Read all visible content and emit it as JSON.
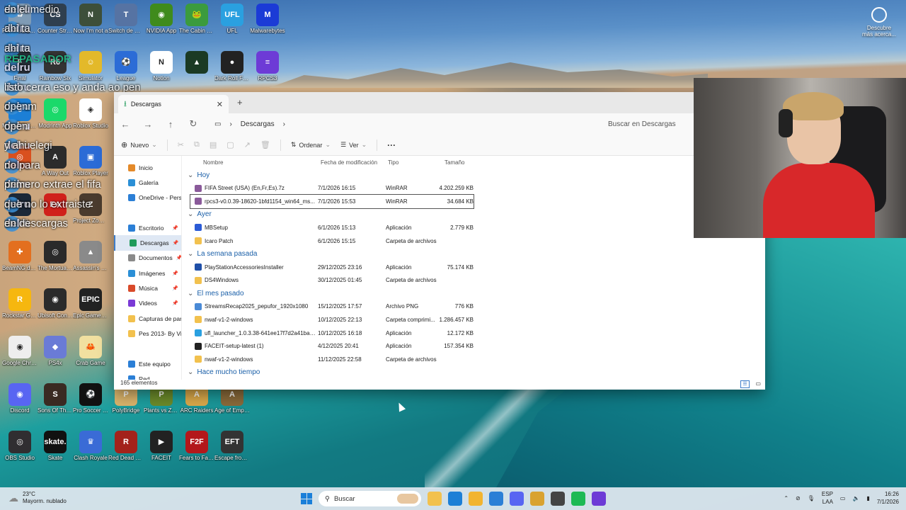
{
  "desktop_icons": [
    {
      "label": "Papelera de reciclaje",
      "color": "#7f9bb5",
      "glyph": "♻",
      "col": 0,
      "row": 0
    },
    {
      "label": "Counter Strike",
      "color": "#2f3f4f",
      "glyph": "CS",
      "col": 1,
      "row": 0
    },
    {
      "label": "Now I'm not a",
      "color": "#3d4f3a",
      "glyph": "N",
      "col": 2,
      "row": 0
    },
    {
      "label": "Switch de Eggs",
      "color": "#5673a3",
      "glyph": "T",
      "col": 3,
      "row": 0
    },
    {
      "label": "NVIDIA App",
      "color": "#3f8b1c",
      "glyph": "◉",
      "col": 4,
      "row": 0
    },
    {
      "label": "The Cabin Factory",
      "color": "#3b9b3e",
      "glyph": "🐸",
      "col": 5,
      "row": 0
    },
    {
      "label": "UFL",
      "color": "#2aa0e0",
      "glyph": "UFL",
      "col": 6,
      "row": 0
    },
    {
      "label": "Malwarebytes",
      "color": "#1b3bd6",
      "glyph": "M",
      "col": 7,
      "row": 0
    },
    {
      "label": "Final",
      "color": "#27303a",
      "glyph": "F",
      "col": 0,
      "row": 1
    },
    {
      "label": "Rainbow Six",
      "color": "#333",
      "glyph": "R6",
      "col": 1,
      "row": 1
    },
    {
      "label": "Simulator",
      "color": "#e3b92a",
      "glyph": "☺",
      "col": 2,
      "row": 1
    },
    {
      "label": "League",
      "color": "#2c6cd6",
      "glyph": "⚽",
      "col": 3,
      "row": 1
    },
    {
      "label": "Notion",
      "color": "#fff",
      "glyph": "N",
      "col": 4,
      "row": 1
    },
    {
      "label": "",
      "color": "#1b3a24",
      "glyph": "▲",
      "col": 5,
      "row": 1
    },
    {
      "label": "Dark Roll Free Kick Challe...",
      "color": "#222",
      "glyph": "●",
      "col": 6,
      "row": 1
    },
    {
      "label": "RPCS3",
      "color": "#6d3bd6",
      "glyph": "≡",
      "col": 7,
      "row": 1
    },
    {
      "label": "Microsoft Edge",
      "color": "#1c7fd6",
      "glyph": "e",
      "col": 0,
      "row": 2
    },
    {
      "label": "Modrinth App",
      "color": "#1bd96a",
      "glyph": "◎",
      "col": 1,
      "row": 2
    },
    {
      "label": "Roblox Studio",
      "color": "#fff",
      "glyph": "◈",
      "col": 2,
      "row": 2
    },
    {
      "label": "",
      "color": "#d9501f",
      "glyph": "◎",
      "col": 0,
      "row": 3
    },
    {
      "label": "A Way Out",
      "color": "#2b2b2b",
      "glyph": "A",
      "col": 1,
      "row": 3
    },
    {
      "label": "Roblox Player",
      "color": "#2b6bd6",
      "glyph": "▣",
      "col": 2,
      "row": 3
    },
    {
      "label": "Steam",
      "color": "#1b2838",
      "glyph": "S",
      "col": 0,
      "row": 4
    },
    {
      "label": "",
      "color": "#d0211b",
      "glyph": "EA",
      "col": 1,
      "row": 4
    },
    {
      "label": "Project Zomboid",
      "color": "#4a3b2e",
      "glyph": "Z",
      "col": 2,
      "row": 4
    },
    {
      "label": "BeamNG.drive",
      "color": "#e36f1f",
      "glyph": "✚",
      "col": 0,
      "row": 5
    },
    {
      "label": "The Mortuary Assistant",
      "color": "#2a2a2a",
      "glyph": "◎",
      "col": 1,
      "row": 5
    },
    {
      "label": "Assassin's Creed",
      "color": "#8a8a8a",
      "glyph": "▲",
      "col": 2,
      "row": 5
    },
    {
      "label": "Rockstar Games",
      "color": "#f6b70f",
      "glyph": "R",
      "col": 0,
      "row": 6
    },
    {
      "label": "Ubisoft Connect",
      "color": "#2b2b2b",
      "glyph": "◉",
      "col": 1,
      "row": 6
    },
    {
      "label": "Epic Games Launcher",
      "color": "#222",
      "glyph": "EPIC",
      "col": 2,
      "row": 6
    },
    {
      "label": "Google Chrome",
      "color": "#eee",
      "glyph": "◉",
      "col": 0,
      "row": 7
    },
    {
      "label": "PS4x",
      "color": "#6a7bd6",
      "glyph": "◆",
      "col": 1,
      "row": 7
    },
    {
      "label": "Crab Game",
      "color": "#f1e0a0",
      "glyph": "🦀",
      "col": 2,
      "row": 7
    },
    {
      "label": "Discord",
      "color": "#5865f2",
      "glyph": "◉",
      "col": 0,
      "row": 8
    },
    {
      "label": "Sons Of The Forest",
      "color": "#3a2a22",
      "glyph": "S",
      "col": 1,
      "row": 8
    },
    {
      "label": "Pro Soccer Online",
      "color": "#111",
      "glyph": "⚽",
      "col": 2,
      "row": 8
    },
    {
      "label": "PolyBridge",
      "color": "#d9b36b",
      "glyph": "P",
      "col": 3,
      "row": 8
    },
    {
      "label": "Plants vs Zombies Tr...",
      "color": "#6b8a2a",
      "glyph": "P",
      "col": 4,
      "row": 8
    },
    {
      "label": "ARC Raiders",
      "color": "#d9a84a",
      "glyph": "A",
      "col": 5,
      "row": 8
    },
    {
      "label": "Age of Empires",
      "color": "#8a6a3a",
      "glyph": "A",
      "col": 6,
      "row": 8
    },
    {
      "label": "OBS Studio",
      "color": "#302e31",
      "glyph": "◎",
      "col": 0,
      "row": 9
    },
    {
      "label": "Skate",
      "color": "#111",
      "glyph": "skate.",
      "col": 1,
      "row": 9
    },
    {
      "label": "Clash Royale",
      "color": "#3a6bd6",
      "glyph": "♛",
      "col": 2,
      "row": 9
    },
    {
      "label": "Red Dead Redempti...",
      "color": "#a3221b",
      "glyph": "R",
      "col": 3,
      "row": 9
    },
    {
      "label": "FACEIT",
      "color": "#222",
      "glyph": "▶",
      "col": 4,
      "row": 9
    },
    {
      "label": "Fears to Fathom",
      "color": "#b3171b",
      "glyph": "F2F",
      "col": 5,
      "row": 9
    },
    {
      "label": "Escape from Tarkov",
      "color": "#333",
      "glyph": "EFT",
      "col": 6,
      "row": 9
    }
  ],
  "chat": [
    {
      "user": "delru",
      "msg": "en el medio"
    },
    {
      "user": "delru",
      "msg": "ahi ta"
    },
    {
      "user": "delru",
      "msg": "ahi ta"
    },
    {
      "user": "delru",
      "msg": ""
    },
    {
      "user": "delru",
      "msg": "listo cerra eso y anda ao pen"
    },
    {
      "user": "delru",
      "msg": "openm"
    },
    {
      "user": "delru",
      "msg": "open"
    },
    {
      "user": "delru",
      "msg": "y ahi elegi"
    },
    {
      "user": "delru",
      "msg": "no para"
    },
    {
      "user": "delru",
      "msg": "primero extrae el fifa"
    },
    {
      "user": "delru",
      "msg": "que no lo extraiste"
    },
    {
      "user": "delru",
      "msg": "en descargas"
    }
  ],
  "chat_banner": "REPASADOR",
  "discover": {
    "label": "Descubre más acerca..."
  },
  "explorer": {
    "tab_title": "Descargas",
    "breadcrumb": "Descargas",
    "search_placeholder": "Buscar en Descargas",
    "toolbar": {
      "new": "Nuevo",
      "sort": "Ordenar",
      "view": "Ver",
      "more": "···"
    },
    "columns": {
      "name": "Nombre",
      "date": "Fecha de modificación",
      "type": "Tipo",
      "size": "Tamaño"
    },
    "sidebar": [
      {
        "label": "Inicio",
        "icon": "home-icon",
        "color": "#e48a2a",
        "pin": false,
        "sel": false
      },
      {
        "label": "Galería",
        "icon": "gallery-icon",
        "color": "#2b8fd6",
        "pin": false,
        "sel": false
      },
      {
        "label": "OneDrive - Pers",
        "icon": "cloud-icon",
        "color": "#2b7fd6",
        "pin": false,
        "sel": false
      },
      {
        "label": "",
        "icon": "",
        "color": "transparent",
        "pin": false,
        "sel": false
      },
      {
        "label": "Escritorio",
        "icon": "desktop-icon",
        "color": "#2b7fd6",
        "pin": true,
        "sel": false
      },
      {
        "label": "Descargas",
        "icon": "download-icon",
        "color": "#1f9a5a",
        "pin": true,
        "sel": true
      },
      {
        "label": "Documentos",
        "icon": "document-icon",
        "color": "#8a8a8a",
        "pin": true,
        "sel": false
      },
      {
        "label": "Imágenes",
        "icon": "image-icon",
        "color": "#2b8fd6",
        "pin": true,
        "sel": false
      },
      {
        "label": "Música",
        "icon": "music-icon",
        "color": "#d94a2a",
        "pin": true,
        "sel": false
      },
      {
        "label": "Videos",
        "icon": "video-icon",
        "color": "#7a3ad6",
        "pin": true,
        "sel": false
      },
      {
        "label": "Capturas de par",
        "icon": "folder-icon",
        "color": "#f2c14e",
        "pin": false,
        "sel": false
      },
      {
        "label": "Pes 2013- By Vir",
        "icon": "folder-icon",
        "color": "#f2c14e",
        "pin": false,
        "sel": false
      },
      {
        "label": "",
        "icon": "",
        "color": "transparent",
        "pin": false,
        "sel": false
      },
      {
        "label": "Este equipo",
        "icon": "computer-icon",
        "color": "#2b7fd6",
        "pin": false,
        "sel": false
      },
      {
        "label": "Red",
        "icon": "network-icon",
        "color": "#2b7fd6",
        "pin": false,
        "sel": false
      }
    ],
    "groups": [
      {
        "title": "Hoy",
        "files": [
          {
            "name": "FIFA Street (USA) (En,Fr,Es).7z",
            "date": "7/1/2026 16:15",
            "type": "WinRAR",
            "size": "4.202.259 KB",
            "color": "#8a5a9a",
            "sel": false
          },
          {
            "name": "rpcs3-v0.0.39-18620-1bfd1154_win64_ms...",
            "date": "7/1/2026 15:53",
            "type": "WinRAR",
            "size": "34.684 KB",
            "color": "#8a5a9a",
            "sel": true
          }
        ]
      },
      {
        "title": "Ayer",
        "files": [
          {
            "name": "MBSetup",
            "date": "6/1/2026 15:13",
            "type": "Aplicación",
            "size": "2.779 KB",
            "color": "#2b5bd6",
            "sel": false
          },
          {
            "name": "Icaro Patch",
            "date": "6/1/2026 15:15",
            "type": "Carpeta de archivos",
            "size": "",
            "color": "#f2c14e",
            "sel": false
          }
        ]
      },
      {
        "title": "La semana pasada",
        "files": [
          {
            "name": "PlayStationAccessoriesInstaller",
            "date": "29/12/2025 23:16",
            "type": "Aplicación",
            "size": "75.174 KB",
            "color": "#1f4fa8",
            "sel": false
          },
          {
            "name": "DS4Windows",
            "date": "30/12/2025 01:45",
            "type": "Carpeta de archivos",
            "size": "",
            "color": "#f2c14e",
            "sel": false
          }
        ]
      },
      {
        "title": "El mes pasado",
        "files": [
          {
            "name": "StreamsRecap2025_pepufor_1920x1080",
            "date": "15/12/2025 17:57",
            "type": "Archivo PNG",
            "size": "776 KB",
            "color": "#4a8ad6",
            "sel": false
          },
          {
            "name": "nwaf-v1-2-windows",
            "date": "10/12/2025 22:13",
            "type": "Carpeta comprimi...",
            "size": "1.286.457 KB",
            "color": "#f2c14e",
            "sel": false
          },
          {
            "name": "ufl_launcher_1.0.3.38-641ee17f7d2a41ba9...",
            "date": "10/12/2025 16:18",
            "type": "Aplicación",
            "size": "12.172 KB",
            "color": "#2aa0e0",
            "sel": false
          },
          {
            "name": "FACEIT-setup-latest (1)",
            "date": "4/12/2025 20:41",
            "type": "Aplicación",
            "size": "157.354 KB",
            "color": "#222",
            "sel": false
          },
          {
            "name": "nwaf-v1-2-windows",
            "date": "11/12/2025 22:58",
            "type": "Carpeta de archivos",
            "size": "",
            "color": "#f2c14e",
            "sel": false
          }
        ]
      },
      {
        "title": "Hace mucho tiempo",
        "files": []
      }
    ],
    "status": "165 elementos"
  },
  "taskbar": {
    "weather_temp": "23°C",
    "weather_desc": "Mayorm. nublado",
    "search": "Buscar",
    "apps": [
      {
        "name": "file-explorer-icon",
        "color": "#f2c14e"
      },
      {
        "name": "edge-icon",
        "color": "#1c7fd6"
      },
      {
        "name": "folder-icon",
        "color": "#f2b430"
      },
      {
        "name": "store-icon",
        "color": "#2b7fd6"
      },
      {
        "name": "discord-icon",
        "color": "#5865f2"
      },
      {
        "name": "chrome-icon",
        "color": "#d9a230"
      },
      {
        "name": "obs-icon",
        "color": "#444"
      },
      {
        "name": "spotify-icon",
        "color": "#1db954"
      },
      {
        "name": "rpcs3-icon",
        "color": "#6d3bd6"
      }
    ],
    "lang": "ESP",
    "lang2": "LAA",
    "time": "16:26",
    "date": "7/1/2026"
  },
  "colors": {
    "accent": "#3d7cc9",
    "selection": "#dfe8f4"
  }
}
